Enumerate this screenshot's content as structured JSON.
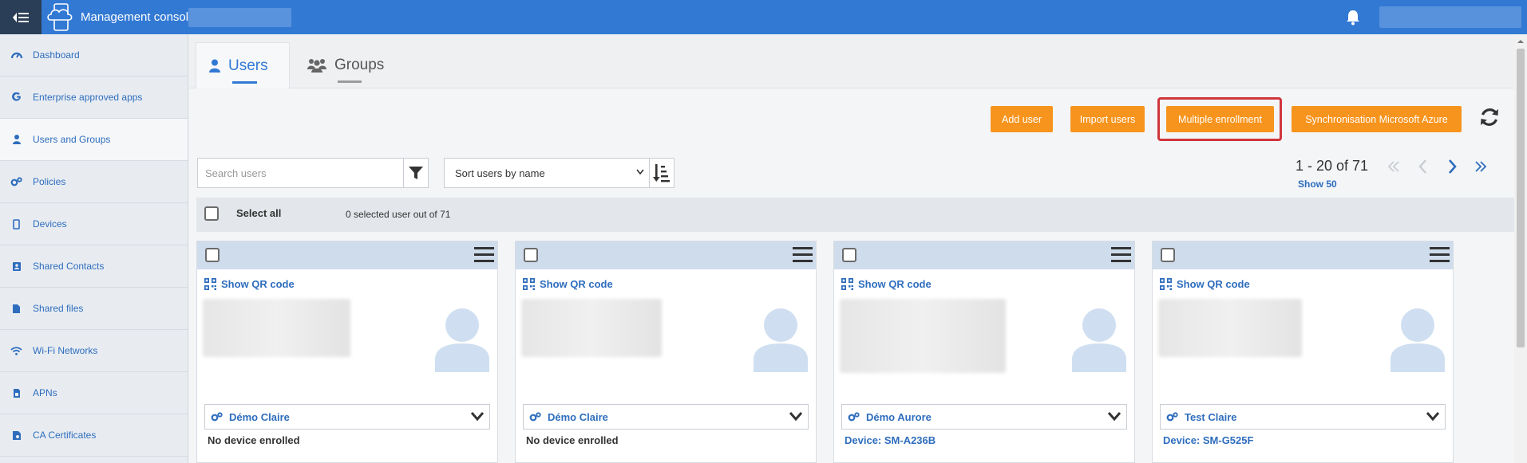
{
  "header": {
    "title": "Management console",
    "menu_icon": "hamburger-icon",
    "logo_icon": "cloud-device-icon",
    "notification_icon": "bell-icon"
  },
  "sidebar": {
    "items": [
      {
        "label": "Dashboard",
        "icon": "dashboard-icon"
      },
      {
        "label": "Enterprise approved apps",
        "icon": "google-icon"
      },
      {
        "label": "Users and Groups",
        "icon": "user-icon",
        "active": true
      },
      {
        "label": "Policies",
        "icon": "gears-icon"
      },
      {
        "label": "Devices",
        "icon": "mobile-icon"
      },
      {
        "label": "Shared Contacts",
        "icon": "contacts-icon"
      },
      {
        "label": "Shared files",
        "icon": "file-icon"
      },
      {
        "label": "Wi-Fi Networks",
        "icon": "wifi-icon"
      },
      {
        "label": "APNs",
        "icon": "sim-icon"
      },
      {
        "label": "CA Certificates",
        "icon": "certificate-icon"
      }
    ]
  },
  "tabs": [
    {
      "label": "Users",
      "active": true
    },
    {
      "label": "Groups",
      "active": false
    }
  ],
  "actions": {
    "add_user": "Add user",
    "import_users": "Import users",
    "multiple_enrollment": "Multiple enrollment",
    "sync_azure": "Synchronisation Microsoft Azure"
  },
  "search": {
    "placeholder": "Search users",
    "value": ""
  },
  "sort": {
    "selected": "Sort users by name"
  },
  "pagination": {
    "range": "1 - 20 of 71",
    "show": "Show 50"
  },
  "selection": {
    "select_all": "Select all",
    "count": "0 selected user out of 71"
  },
  "cards": [
    {
      "qr_label": "Show QR code",
      "owner": "Démo Claire",
      "device": "No device enrolled",
      "device_link": false
    },
    {
      "qr_label": "Show QR code",
      "owner": "Démo Claire",
      "device": "No device enrolled",
      "device_link": false
    },
    {
      "qr_label": "Show QR code",
      "owner": "Démo Aurore",
      "device": "Device: SM-A236B",
      "device_link": true
    },
    {
      "qr_label": "Show QR code",
      "owner": "Test Claire",
      "device": "Device: SM-G525F",
      "device_link": true
    }
  ],
  "colors": {
    "header": "#3279d4",
    "action_button": "#f7941d",
    "highlight": "#d0363b",
    "link": "#2e6dbd"
  }
}
